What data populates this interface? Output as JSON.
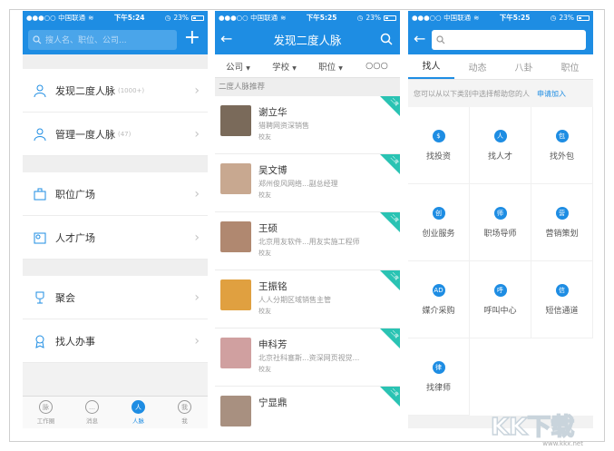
{
  "status": {
    "carrier": "●●●○○ 中国联通",
    "battery": "23%"
  },
  "screen1": {
    "time": "下午5:24",
    "search_placeholder": "搜人名、职位、公司...",
    "items": [
      {
        "label": "发现二度人脉",
        "count": "(1000+)"
      },
      {
        "label": "管理一度人脉",
        "count": "(47)"
      },
      {
        "label": "职位广场",
        "count": ""
      },
      {
        "label": "人才广场",
        "count": ""
      },
      {
        "label": "聚会",
        "count": ""
      },
      {
        "label": "找人办事",
        "count": ""
      }
    ],
    "tabbar": [
      {
        "label": "工作圈",
        "icon": "脉"
      },
      {
        "label": "消息",
        "icon": "…"
      },
      {
        "label": "人脉",
        "icon": "人"
      },
      {
        "label": "我",
        "icon": "我"
      }
    ]
  },
  "screen2": {
    "time": "下午5:25",
    "title": "发现二度人脉",
    "filters": [
      "公司",
      "学校",
      "职位",
      "○○○"
    ],
    "section_title": "二度人脉推荐",
    "corner_label": "二度",
    "people": [
      {
        "name": "谢立华",
        "desc": "猎聘网资深销售",
        "tag": "校友"
      },
      {
        "name": "吴文博",
        "desc": "郑州俊风网络...副总经理",
        "tag": "校友"
      },
      {
        "name": "王硕",
        "desc": "北京用友软件...用友实施工程师",
        "tag": "校友"
      },
      {
        "name": "王振铭",
        "desc": "人人分期区域销售主管",
        "tag": "校友"
      },
      {
        "name": "申科芳",
        "desc": "北京社科塞斯...资深网页视觉...",
        "tag": "校友"
      },
      {
        "name": "宁显鼎",
        "desc": "",
        "tag": ""
      }
    ]
  },
  "screen3": {
    "time": "下午5:25",
    "tabs": [
      "找人",
      "动态",
      "八卦",
      "职位"
    ],
    "hint": "您可以从以下类别中选择帮助您的人",
    "apply": "申请加入",
    "categories": [
      {
        "label": "找投资",
        "icon": "$"
      },
      {
        "label": "找人才",
        "icon": "人"
      },
      {
        "label": "找外包",
        "icon": "包"
      },
      {
        "label": "创业服务",
        "icon": "创"
      },
      {
        "label": "职场导师",
        "icon": "师"
      },
      {
        "label": "营销策划",
        "icon": "营"
      },
      {
        "label": "媒介采购",
        "icon": "AD"
      },
      {
        "label": "呼叫中心",
        "icon": "呼"
      },
      {
        "label": "短信通道",
        "icon": "信"
      },
      {
        "label": "找律师",
        "icon": "律"
      }
    ]
  },
  "watermark": {
    "text": "KK下载",
    "url": "www.kkx.net"
  },
  "colors": {
    "brand": "#1e8de3",
    "corner": "#2ac3b3"
  }
}
